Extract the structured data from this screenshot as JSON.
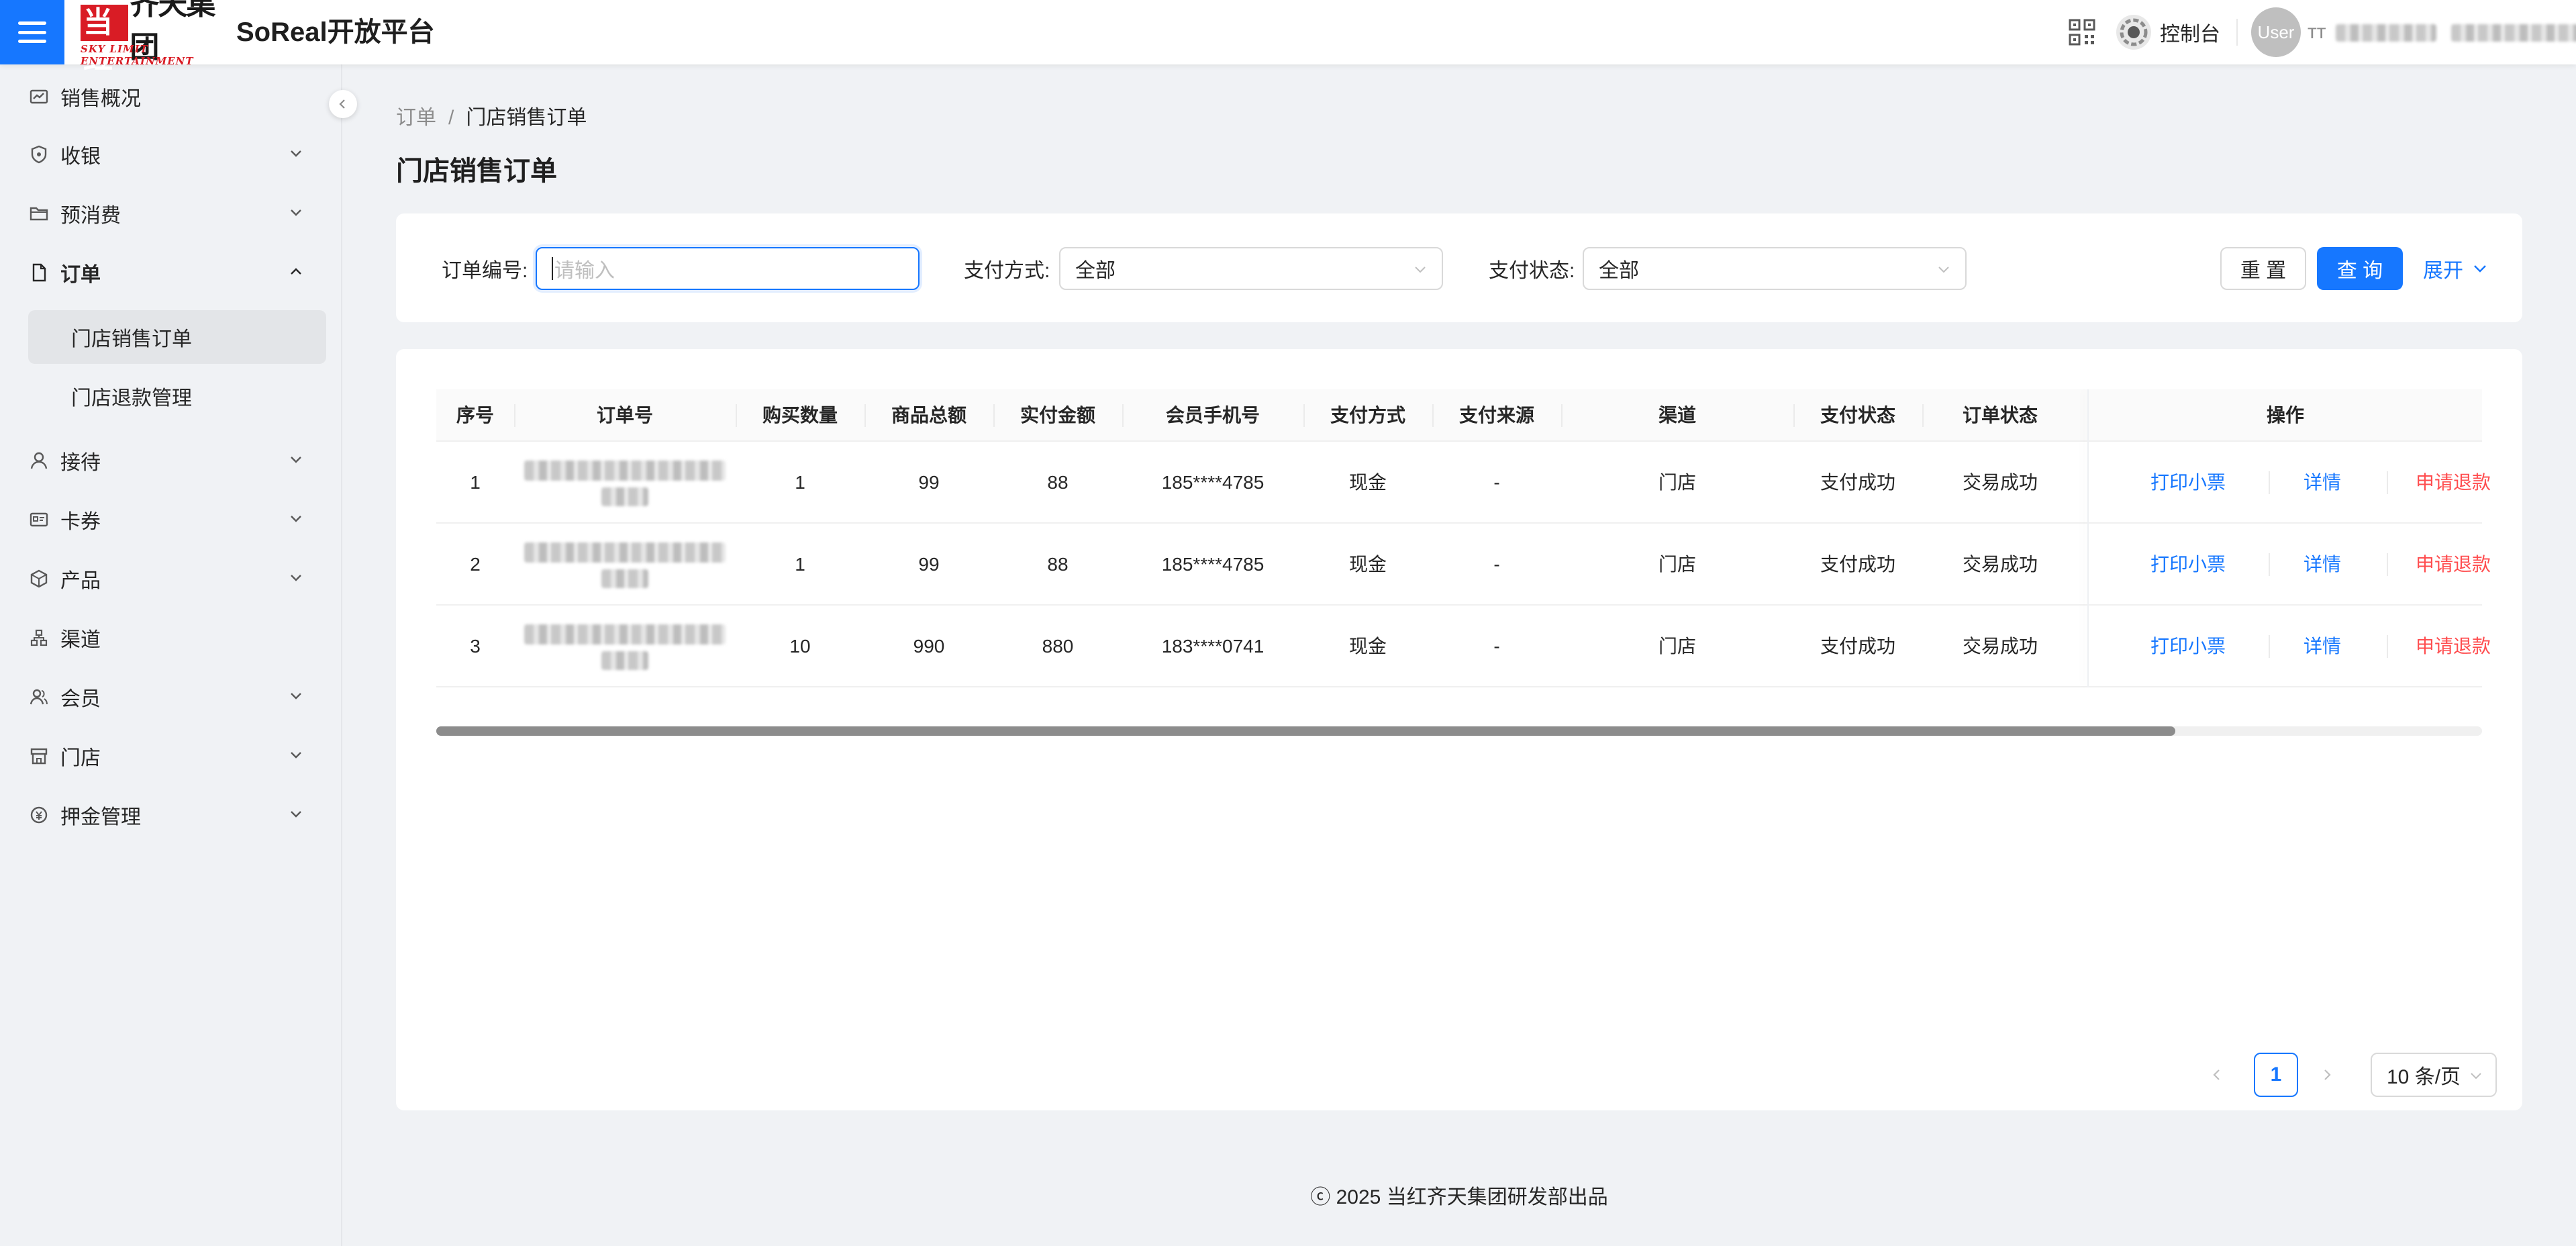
{
  "header": {
    "logo_text_red": "当红",
    "logo_text_black": "齐天集团",
    "logo_subtitle": "SKY LIMIT ENTERTAINMENT",
    "platform_title": "SoReal开放平台",
    "console_label": "控制台",
    "avatar_text": "User",
    "user_name_visible": "тт"
  },
  "sidebar": {
    "items": [
      {
        "label": "销售概况",
        "icon": "dashboard-icon"
      },
      {
        "label": "收银",
        "icon": "shield-icon"
      },
      {
        "label": "预消费",
        "icon": "folder-icon"
      },
      {
        "label": "订单",
        "icon": "file-icon"
      },
      {
        "label": "接待",
        "icon": "user-icon"
      },
      {
        "label": "卡券",
        "icon": "card-icon"
      },
      {
        "label": "产品",
        "icon": "cube-icon"
      },
      {
        "label": "渠道",
        "icon": "cluster-icon"
      },
      {
        "label": "会员",
        "icon": "team-icon"
      },
      {
        "label": "门店",
        "icon": "shop-icon"
      },
      {
        "label": "押金管理",
        "icon": "money-icon"
      }
    ],
    "order_sub": [
      "门店销售订单",
      "门店退款管理"
    ]
  },
  "breadcrumb": {
    "parent": "订单",
    "separator": "/",
    "current": "门店销售订单"
  },
  "page_title": "门店销售订单",
  "filters": {
    "order_no_label": "订单编号:",
    "order_no_placeholder": "请输入",
    "pay_method_label": "支付方式:",
    "pay_method_value": "全部",
    "pay_status_label": "支付状态:",
    "pay_status_value": "全部",
    "reset_label": "重 置",
    "query_label": "查 询",
    "expand_label": "展开"
  },
  "table": {
    "columns": [
      "序号",
      "订单号",
      "购买数量",
      "商品总额",
      "实付金额",
      "会员手机号",
      "支付方式",
      "支付来源",
      "渠道",
      "支付状态",
      "订单状态",
      "操作"
    ],
    "rows": [
      {
        "idx": "1",
        "qty": "1",
        "total": "99",
        "paid": "88",
        "phone": "185****4785",
        "method": "现金",
        "source": "-",
        "channel": "门店",
        "pay_status": "支付成功",
        "order_status": "交易成功"
      },
      {
        "idx": "2",
        "qty": "1",
        "total": "99",
        "paid": "88",
        "phone": "185****4785",
        "method": "现金",
        "source": "-",
        "channel": "门店",
        "pay_status": "支付成功",
        "order_status": "交易成功"
      },
      {
        "idx": "3",
        "qty": "10",
        "total": "990",
        "paid": "880",
        "phone": "183****0741",
        "method": "现金",
        "source": "-",
        "channel": "门店",
        "pay_status": "支付成功",
        "order_status": "交易成功"
      }
    ],
    "actions": {
      "print": "打印小票",
      "detail": "详情",
      "refund": "申请退款"
    },
    "horizontal_scroll_fraction": 0.85
  },
  "pagination": {
    "current_page": "1",
    "page_size": "10 条/页"
  },
  "footer": "ⓒ 2025 当红齐天集团研发部出品",
  "colors": {
    "primary": "#1677ff",
    "danger": "#ff4d4f",
    "brand_red": "#d91c25"
  }
}
